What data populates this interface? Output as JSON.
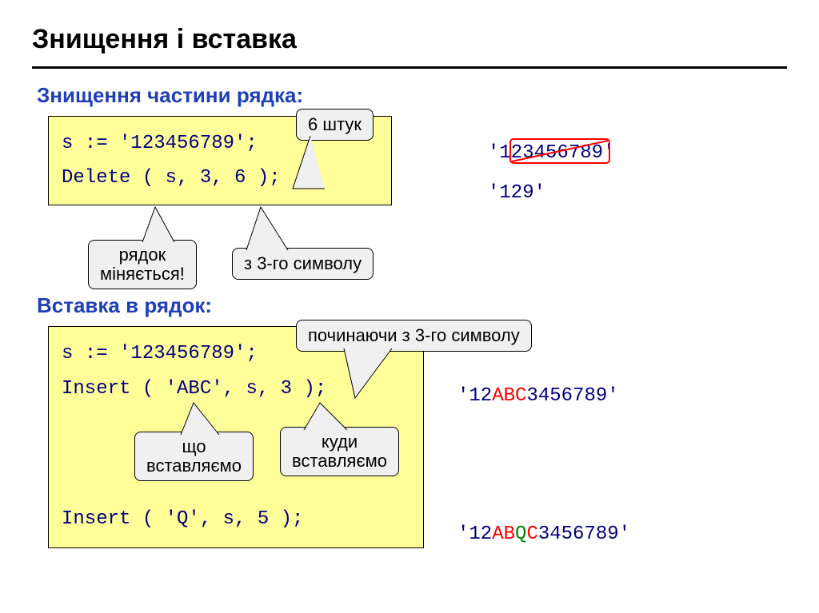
{
  "title": "Знищення і вставка",
  "section1": {
    "heading": "Знищення частини рядка:",
    "code_line1": "s := '123456789';",
    "code_line2": "Delete ( s, 3, 6 );",
    "result1_full": "'123456789'",
    "result2": "'129'",
    "callout_count": "6 штук",
    "callout_rowchanges": "рядок\nміняється!",
    "callout_from3": "з 3-го символу"
  },
  "section2": {
    "heading": "Вставка в рядок:",
    "code_line1": "s := '123456789';",
    "code_line2": "Insert ( 'ABC', s, 3 );",
    "code_line3": "Insert ( 'Q', s, 5 );",
    "result1_pre": "'12",
    "result1_mid": "ABC",
    "result1_post": "3456789'",
    "result2_pre": "'12",
    "result2_ab": "AB",
    "result2_q": "Q",
    "result2_c": "C",
    "result2_post": "3456789'",
    "callout_startfrom3": "починаючи з 3-го символу",
    "callout_what": "що\nвставляємо",
    "callout_where": "куди\nвставляємо"
  }
}
